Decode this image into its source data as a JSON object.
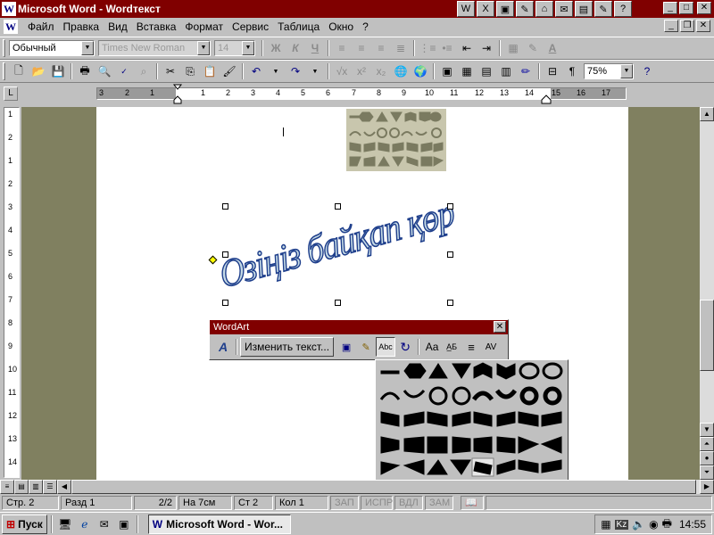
{
  "window": {
    "title": "Microsoft Word - Wordтекст",
    "app_icon_letter": "W",
    "quick_tools": [
      "W",
      "X",
      "▣",
      "✎",
      "⌂",
      "✉",
      "▤",
      "✎",
      "?"
    ],
    "minimize": "_",
    "maximize": "□",
    "close": "✕"
  },
  "menu": {
    "items": [
      "Файл",
      "Правка",
      "Вид",
      "Вставка",
      "Формат",
      "Сервис",
      "Таблица",
      "Окно",
      "?"
    ],
    "doc_minimize": "_",
    "doc_restore": "❐",
    "doc_close": "✕"
  },
  "format_toolbar": {
    "style": "Обычный",
    "font": "Times New Roman",
    "size": "14",
    "bold": "Ж",
    "italic": "К",
    "underline": "Ч"
  },
  "standard_toolbar": {
    "zoom": "75%"
  },
  "ruler": {
    "corner": "L",
    "left_numbers": [
      "3",
      "2",
      "1"
    ],
    "right_numbers": [
      "1",
      "2",
      "3",
      "4",
      "5",
      "6",
      "7",
      "8",
      "9",
      "10",
      "11",
      "12",
      "13",
      "14",
      "15",
      "16",
      "17"
    ],
    "vertical_numbers": [
      "1",
      "2",
      "1",
      "2",
      "3",
      "4",
      "5",
      "6",
      "7",
      "8",
      "9",
      "10",
      "11",
      "12",
      "13",
      "14",
      "15"
    ]
  },
  "wordart": {
    "text": "Озіңіз байқап қөріңіз",
    "color_fill": "#c6dbe6",
    "color_stroke": "#1f3f8c",
    "toolbar_title": "WordArt",
    "edit_text_label": "Изменить текст...",
    "buttons": [
      "insert-wordart",
      "wordart-gallery",
      "format-wordart",
      "wordart-shape",
      "free-rotate",
      "same-letter-heights",
      "vertical-text",
      "alignment",
      "character-spacing"
    ]
  },
  "status": {
    "page": "Стр. 2",
    "section": "Разд 1",
    "pages": "2/2",
    "at": "На 7см",
    "line": "Ст 2",
    "col": "Кол 1",
    "rec": "ЗАП",
    "trk": "ИСПР",
    "ext": "ВДЛ",
    "ovr": "ЗАМ"
  },
  "taskbar": {
    "start": "Пуск",
    "task": "Microsoft Word - Wor...",
    "lang": "Kz",
    "clock": "14:55"
  }
}
